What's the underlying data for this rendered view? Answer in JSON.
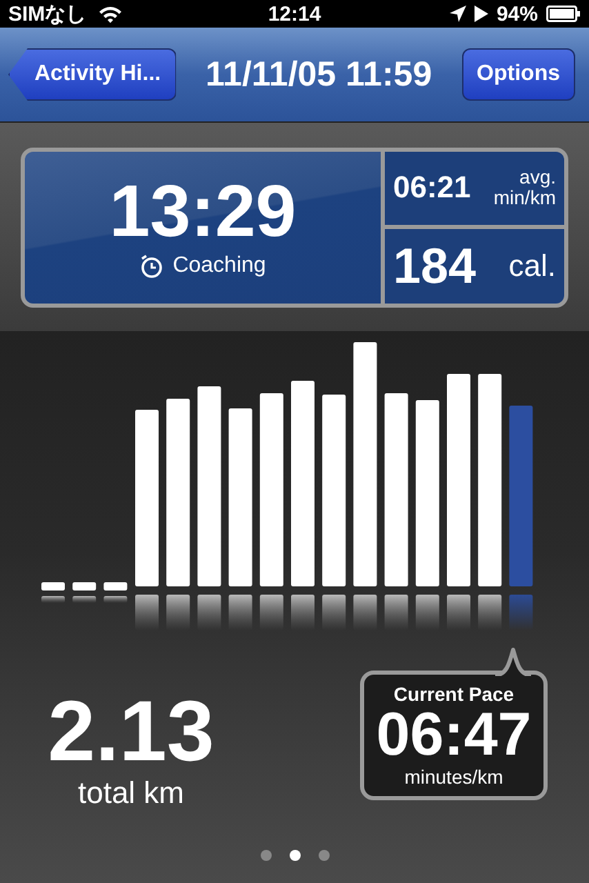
{
  "status_bar": {
    "carrier": "SIMなし",
    "time": "12:14",
    "battery": "94%"
  },
  "nav_bar": {
    "back_button": "Activity Hi...",
    "title": "11/11/05 11:59",
    "options_button": "Options"
  },
  "stats": {
    "duration": "13:29",
    "coaching": "Coaching",
    "avg_pace": "06:21",
    "avg_label": "avg.",
    "avg_unit": "min/km",
    "calories": "184",
    "calories_unit": "cal."
  },
  "distance": {
    "value": "2.13",
    "label": "total km"
  },
  "current_pace": {
    "label": "Current Pace",
    "value": "06:47",
    "unit": "minutes/km"
  },
  "page_dots": [
    {
      "selected": false
    },
    {
      "selected": true
    },
    {
      "selected": false
    }
  ]
}
